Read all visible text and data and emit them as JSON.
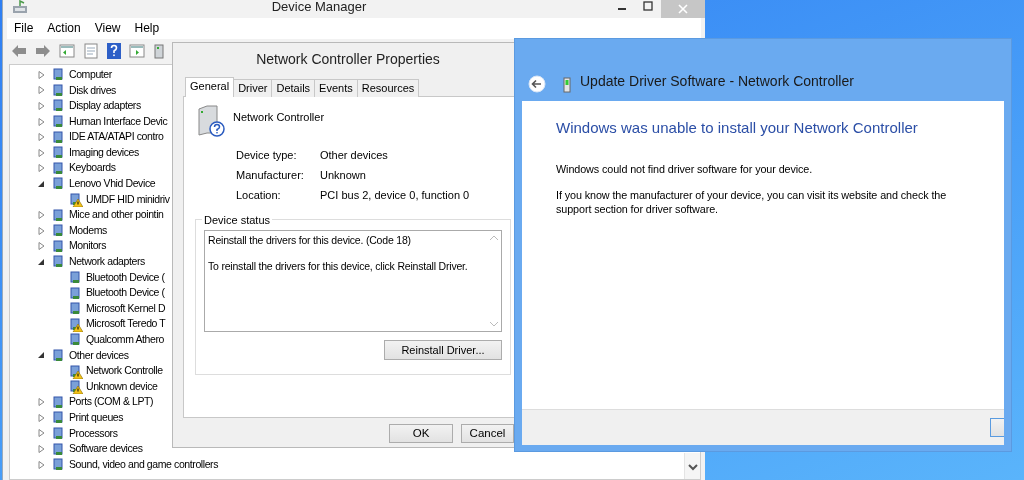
{
  "device_manager": {
    "title": "Device Manager",
    "menu": [
      "File",
      "Action",
      "View",
      "Help"
    ],
    "tree": [
      {
        "label": "Computer",
        "expanded": false
      },
      {
        "label": "Disk drives",
        "expanded": false
      },
      {
        "label": "Display adapters",
        "expanded": false
      },
      {
        "label": "Human Interface Devic",
        "expanded": false
      },
      {
        "label": "IDE ATA/ATAPI contro",
        "expanded": false
      },
      {
        "label": "Imaging devices",
        "expanded": false
      },
      {
        "label": "Keyboards",
        "expanded": false
      },
      {
        "label": "Lenovo Vhid Device",
        "expanded": true,
        "children": [
          {
            "label": "UMDF HID minidriv",
            "warning": true
          }
        ]
      },
      {
        "label": "Mice and other pointin",
        "expanded": false
      },
      {
        "label": "Modems",
        "expanded": false
      },
      {
        "label": "Monitors",
        "expanded": false
      },
      {
        "label": "Network adapters",
        "expanded": true,
        "children": [
          {
            "label": "Bluetooth Device (",
            "warning": false
          },
          {
            "label": "Bluetooth Device (",
            "warning": false
          },
          {
            "label": "Microsoft Kernel D",
            "warning": false
          },
          {
            "label": "Microsoft Teredo T",
            "warning": true
          },
          {
            "label": "Qualcomm Athero",
            "warning": false
          }
        ]
      },
      {
        "label": "Other devices",
        "expanded": true,
        "children": [
          {
            "label": "Network Controlle",
            "warning": true
          },
          {
            "label": "Unknown device",
            "warning": true
          }
        ]
      },
      {
        "label": "Ports (COM & LPT)",
        "expanded": false
      },
      {
        "label": "Print queues",
        "expanded": false
      },
      {
        "label": "Processors",
        "expanded": false
      },
      {
        "label": "Software devices",
        "expanded": false
      },
      {
        "label": "Sound, video and game controllers",
        "expanded": false
      }
    ]
  },
  "properties": {
    "title": "Network Controller Properties",
    "tabs": [
      {
        "label": "General",
        "selected": true
      },
      {
        "label": "Driver",
        "selected": false
      },
      {
        "label": "Details",
        "selected": false
      },
      {
        "label": "Events",
        "selected": false
      },
      {
        "label": "Resources",
        "selected": false
      }
    ],
    "device_name": "Network Controller",
    "fields": [
      {
        "label": "Device type:",
        "value": "Other devices"
      },
      {
        "label": "Manufacturer:",
        "value": "Unknown"
      },
      {
        "label": "Location:",
        "value": "PCI bus 2, device 0, function 0"
      }
    ],
    "status_group": "Device status",
    "status_lines": [
      "Reinstall the drivers for this device. (Code 18)",
      "To reinstall the drivers for this device, click Reinstall Driver."
    ],
    "reinstall_button": "Reinstall Driver...",
    "buttons": [
      "OK",
      "Cancel"
    ]
  },
  "update_driver": {
    "title": "Update Driver Software - Network Controller",
    "heading": "Windows was unable to install your Network Controller",
    "paragraphs": [
      "Windows could not find driver software for your device.",
      "If you know the manufacturer of your device, you can visit its website and check the support section for driver software."
    ]
  }
}
